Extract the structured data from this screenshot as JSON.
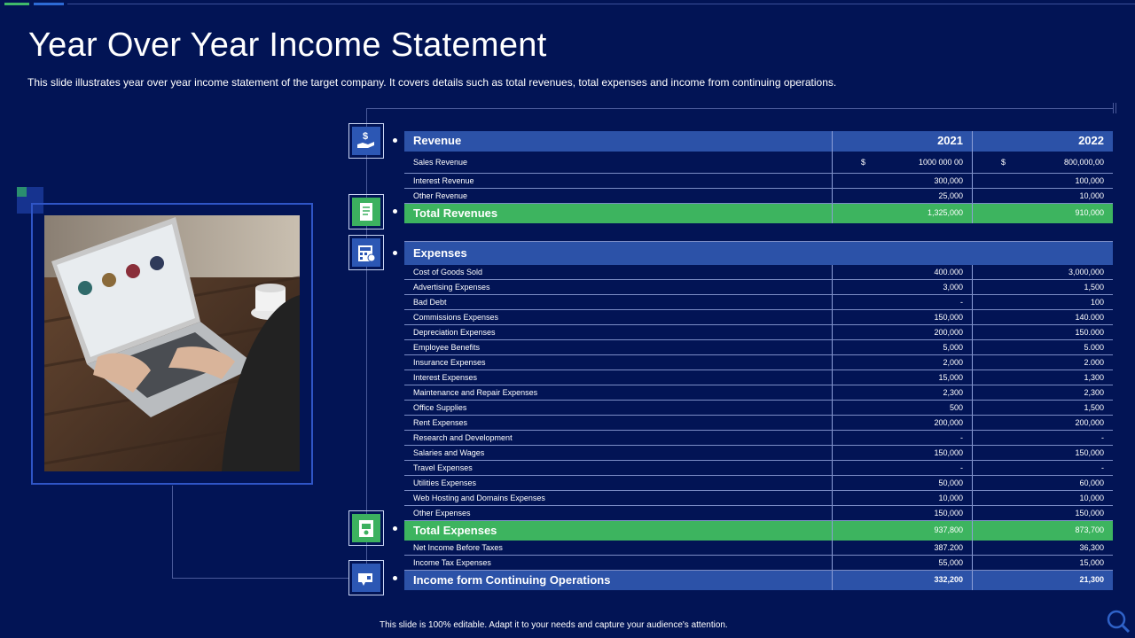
{
  "slide": {
    "title": "Year Over Year Income Statement",
    "subtitle": "This slide illustrates year over year income statement of the target company. It covers details such as total revenues, total expenses and income from continuing operations.",
    "footer": "This slide is 100% editable. Adapt it to your needs and capture your audience's attention."
  },
  "icons": {
    "revenue": "hand-dollar-icon",
    "total_revenues": "receipt-icon",
    "expenses": "calculator-icon",
    "total_expenses": "money-bill-icon",
    "income_operations": "wallet-icon",
    "search": "search-icon"
  },
  "colors": {
    "background": "#021455",
    "header_blue": "#2c52a8",
    "total_green": "#3db45f"
  },
  "table": {
    "revenue_header": {
      "label": "Revenue",
      "y2021": "2021",
      "y2022": "2022"
    },
    "sales_revenue": {
      "label": "Sales Revenue",
      "cur2021": "$",
      "v2021": "1000 000 00",
      "cur2022": "$",
      "v2022": "800,000,00"
    },
    "revenue_rows": [
      {
        "label": "Interest Revenue",
        "v2021": "300,000",
        "v2022": "100,000"
      },
      {
        "label": "Other Revenue",
        "v2021": "25,000",
        "v2022": "10,000"
      }
    ],
    "total_revenues": {
      "label": "Total Revenues",
      "v2021": "1,325,000",
      "v2022": "910,000"
    },
    "expenses_header": {
      "label": "Expenses"
    },
    "expense_rows": [
      {
        "label": "Cost of Goods Sold",
        "v2021": "400.000",
        "v2022": "3,000,000"
      },
      {
        "label": "Advertising Expenses",
        "v2021": "3,000",
        "v2022": "1,500"
      },
      {
        "label": "Bad Debt",
        "v2021": "-",
        "v2022": "100"
      },
      {
        "label": "Commissions Expenses",
        "v2021": "150,000",
        "v2022": "140.000"
      },
      {
        "label": "Depreciation Expenses",
        "v2021": "200,000",
        "v2022": "150.000"
      },
      {
        "label": "Employee Benefits",
        "v2021": "5,000",
        "v2022": "5.000"
      },
      {
        "label": "Insurance Expenses",
        "v2021": "2,000",
        "v2022": "2.000"
      },
      {
        "label": "Interest Expenses",
        "v2021": "15,000",
        "v2022": "1,300"
      },
      {
        "label": "Maintenance and Repair Expenses",
        "v2021": "2,300",
        "v2022": "2,300"
      },
      {
        "label": "Office Supplies",
        "v2021": "500",
        "v2022": "1,500"
      },
      {
        "label": "Rent Expenses",
        "v2021": "200,000",
        "v2022": "200,000"
      },
      {
        "label": "Research and Development",
        "v2021": "-",
        "v2022": "-"
      },
      {
        "label": "Salaries and Wages",
        "v2021": "150,000",
        "v2022": "150,000"
      },
      {
        "label": "Travel Expenses",
        "v2021": "-",
        "v2022": "-"
      },
      {
        "label": "Utilities Expenses",
        "v2021": "50,000",
        "v2022": "60,000"
      },
      {
        "label": "Web Hosting and Domains Expenses",
        "v2021": "10,000",
        "v2022": "10,000"
      },
      {
        "label": "Other Expenses",
        "v2021": "150,000",
        "v2022": "150,000"
      }
    ],
    "total_expenses": {
      "label": "Total Expenses",
      "v2021": "937,800",
      "v2022": "873,700"
    },
    "post_rows": [
      {
        "label": "Net Income Before Taxes",
        "v2021": "387.200",
        "v2022": "36,300"
      },
      {
        "label": "Income Tax Expenses",
        "v2021": "55,000",
        "v2022": "15,000"
      }
    ],
    "income_operations": {
      "label": "Income form Continuing Operations",
      "v2021": "332,200",
      "v2022": "21,300"
    }
  }
}
